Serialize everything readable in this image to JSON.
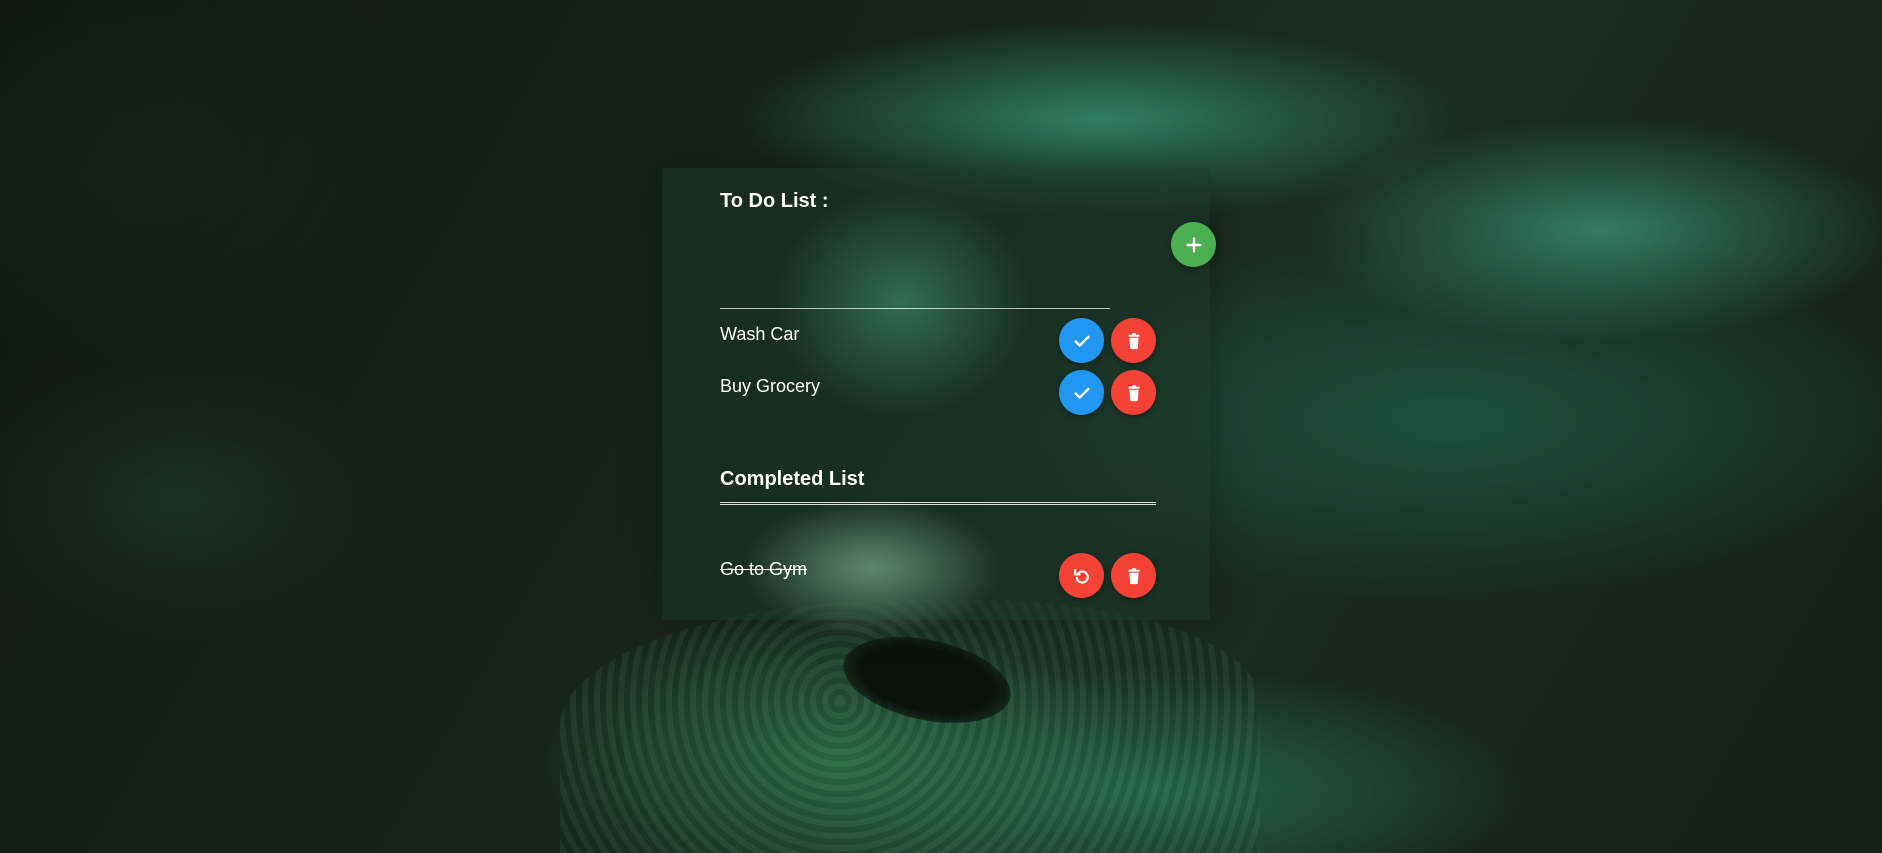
{
  "app": {
    "todo_heading": "To Do List :",
    "completed_heading": "Completed List",
    "new_task_input": {
      "value": "",
      "placeholder": ""
    },
    "add_button_icon": "plus-icon"
  },
  "todo_items": [
    {
      "label": "Wash Car",
      "complete_icon": "check-icon",
      "delete_icon": "trash-icon"
    },
    {
      "label": "Buy Grocery",
      "complete_icon": "check-icon",
      "delete_icon": "trash-icon"
    }
  ],
  "completed_items": [
    {
      "label": "Go to Gym",
      "undo_icon": "undo-icon",
      "delete_icon": "trash-icon"
    }
  ],
  "colors": {
    "add": "#4caf50",
    "complete": "#2196f3",
    "delete": "#f44336",
    "undo": "#f44336"
  }
}
